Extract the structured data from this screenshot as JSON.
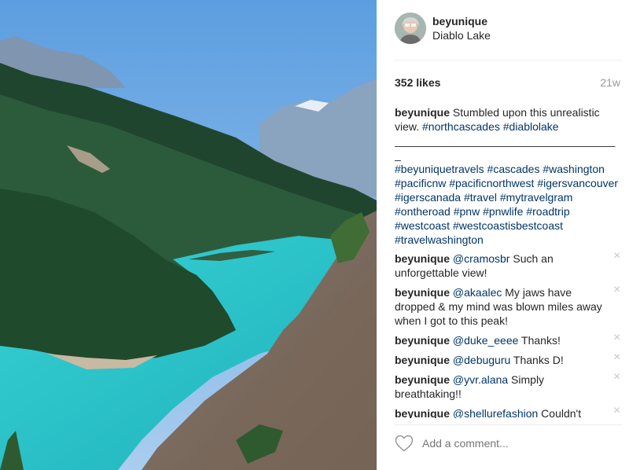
{
  "post": {
    "username": "beyunique",
    "location": "Diablo Lake",
    "likes": "352 likes",
    "time_ago": "21w"
  },
  "caption": {
    "user": "beyunique",
    "text": " Stumbled upon this unrealistic view. ",
    "tags1": [
      "#northcascades",
      "#diablolake"
    ],
    "separator": "____________________________________",
    "separator2": "_",
    "tags2": [
      "#beyuniquetravels",
      "#cascades",
      "#washington",
      "#pacificnw",
      "#pacificnorthwest",
      "#igersvancouver",
      "#igerscanada",
      "#travel",
      "#mytravelgram",
      "#ontheroad",
      "#pnw",
      "#pnwlife",
      "#roadtrip",
      "#westcoast",
      "#westcoastisbestcoast",
      "#travelwashington"
    ]
  },
  "comments": [
    {
      "user": "beyunique",
      "mention": "@cramosbr",
      "text": " Such an unforgettable view!"
    },
    {
      "user": "beyunique",
      "mention": "@akaalec",
      "text": " My jaws have dropped & my mind was blown miles away when I got to this peak!"
    },
    {
      "user": "beyunique",
      "mention": "@duke_eeee",
      "text": " Thanks!"
    },
    {
      "user": "beyunique",
      "mention": "@debuguru",
      "text": " Thanks D!"
    },
    {
      "user": "beyunique",
      "mention": "@yvr.alana",
      "text": " Simply breathtaking!!"
    },
    {
      "user": "beyunique",
      "mention": "@shellurefashion",
      "text": " Couldn't"
    }
  ],
  "delete_glyph": "×",
  "add_comment": {
    "placeholder": "Add a comment..."
  },
  "icons": {
    "like": "heart-icon",
    "delete": "close-icon"
  },
  "colors": {
    "hashtag": "#003569",
    "muted": "#999999",
    "lake": "#2fc3c6"
  }
}
